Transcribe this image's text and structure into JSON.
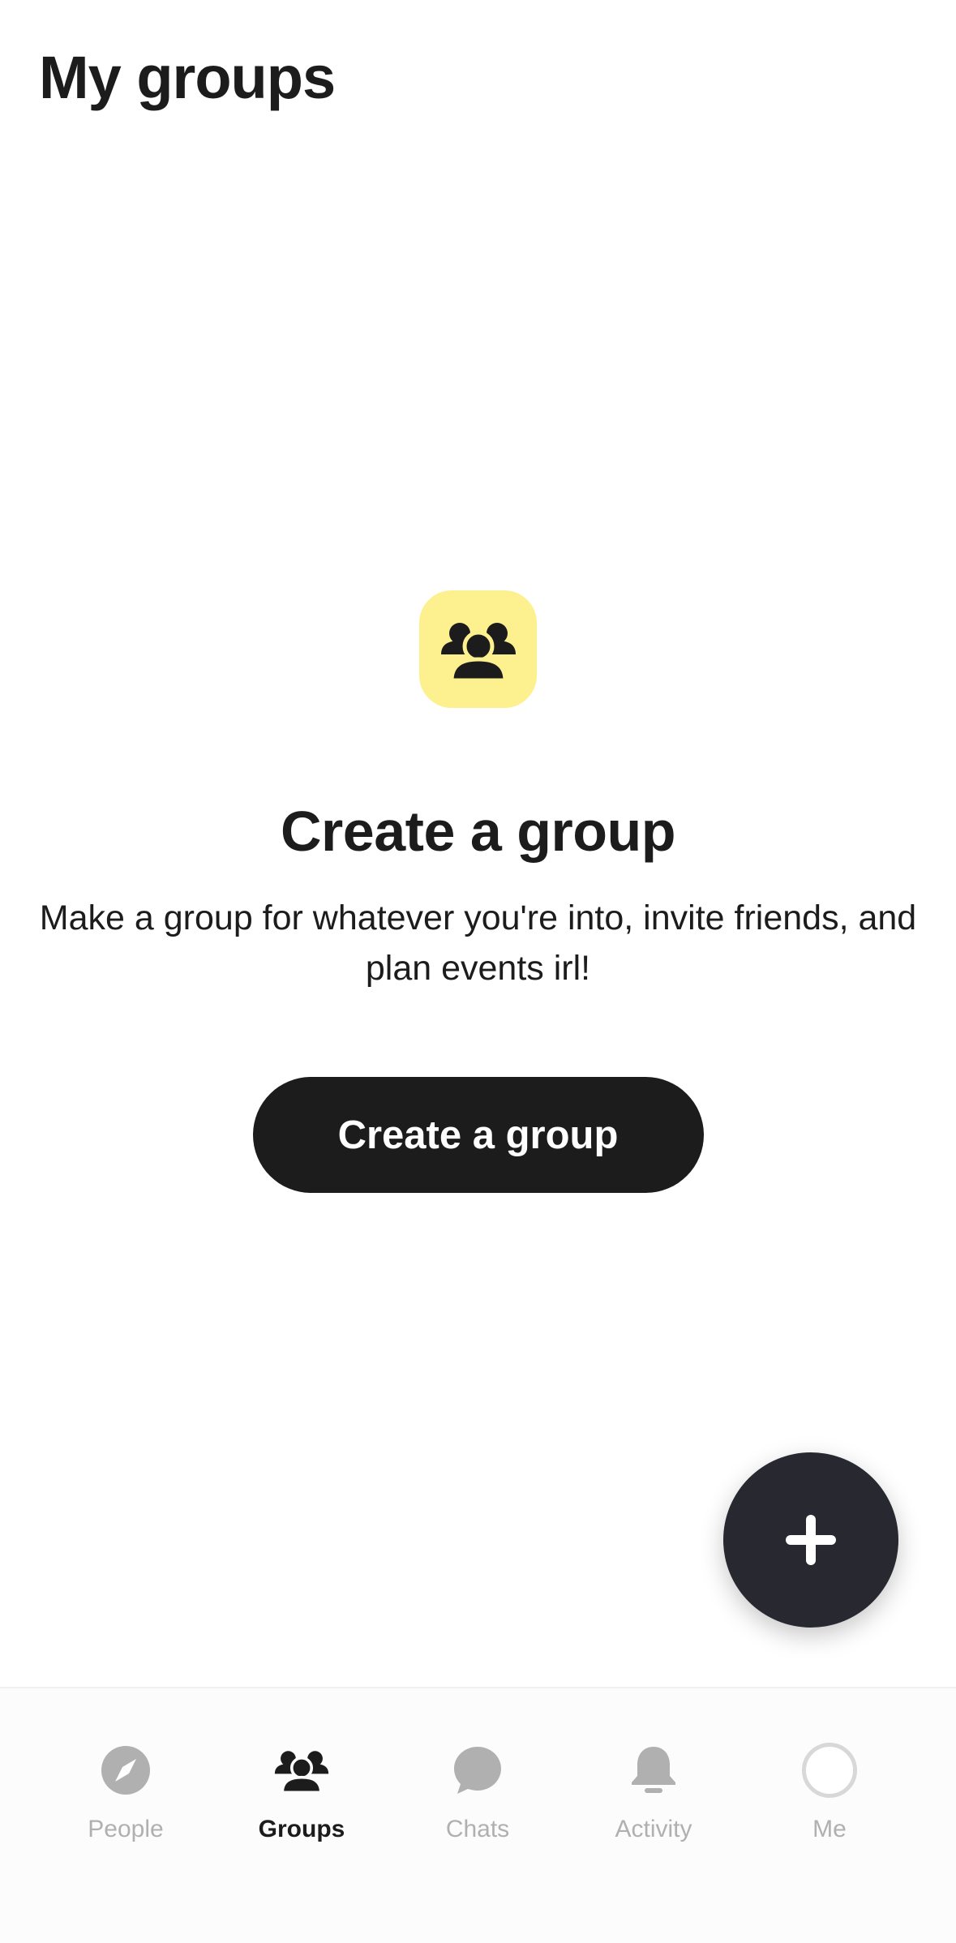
{
  "header": {
    "title": "My groups"
  },
  "empty_state": {
    "icon": "group-icon",
    "title": "Create a group",
    "description": "Make a group for whatever you're into, invite friends, and plan events irl!",
    "button_label": "Create a group"
  },
  "fab": {
    "icon": "plus-icon"
  },
  "nav": {
    "items": [
      {
        "label": "People",
        "icon": "compass-icon",
        "active": false
      },
      {
        "label": "Groups",
        "icon": "group-icon",
        "active": true
      },
      {
        "label": "Chats",
        "icon": "chat-bubble-icon",
        "active": false
      },
      {
        "label": "Activity",
        "icon": "bell-icon",
        "active": false
      },
      {
        "label": "Me",
        "icon": "avatar",
        "active": false
      }
    ]
  },
  "colors": {
    "accent_yellow": "#fdf08f",
    "primary_dark": "#1c1c1c",
    "fab_background": "#272830",
    "inactive_nav": "#b0b0b0"
  }
}
